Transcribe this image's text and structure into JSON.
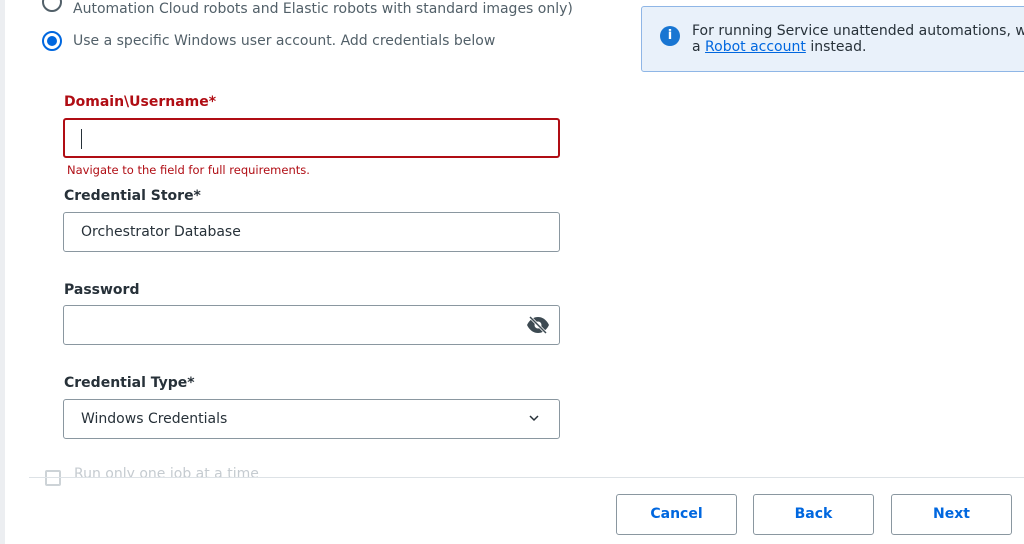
{
  "options": [
    {
      "label": "Automation Cloud robots and Elastic robots with standard images only)",
      "selected": false
    },
    {
      "label": "Use a specific Windows user account. Add credentials below",
      "selected": true
    }
  ],
  "info": {
    "text": "For running Service unattended automations, we r",
    "text2_prefix": "a ",
    "link": "Robot account",
    "text2_suffix": " instead."
  },
  "fields": {
    "domain": {
      "label": "Domain\\Username*",
      "value": "",
      "error": "Navigate to the field for full requirements."
    },
    "store": {
      "label": "Credential Store*",
      "value": "Orchestrator Database"
    },
    "password": {
      "label": "Password",
      "value": ""
    },
    "type": {
      "label": "Credential Type*",
      "value": "Windows Credentials"
    }
  },
  "checkbox": {
    "label": "Run only one job at a time"
  },
  "buttons": {
    "cancel": "Cancel",
    "back": "Back",
    "next": "Next"
  },
  "colors": {
    "accent": "#0067df",
    "error": "#b00d14"
  }
}
